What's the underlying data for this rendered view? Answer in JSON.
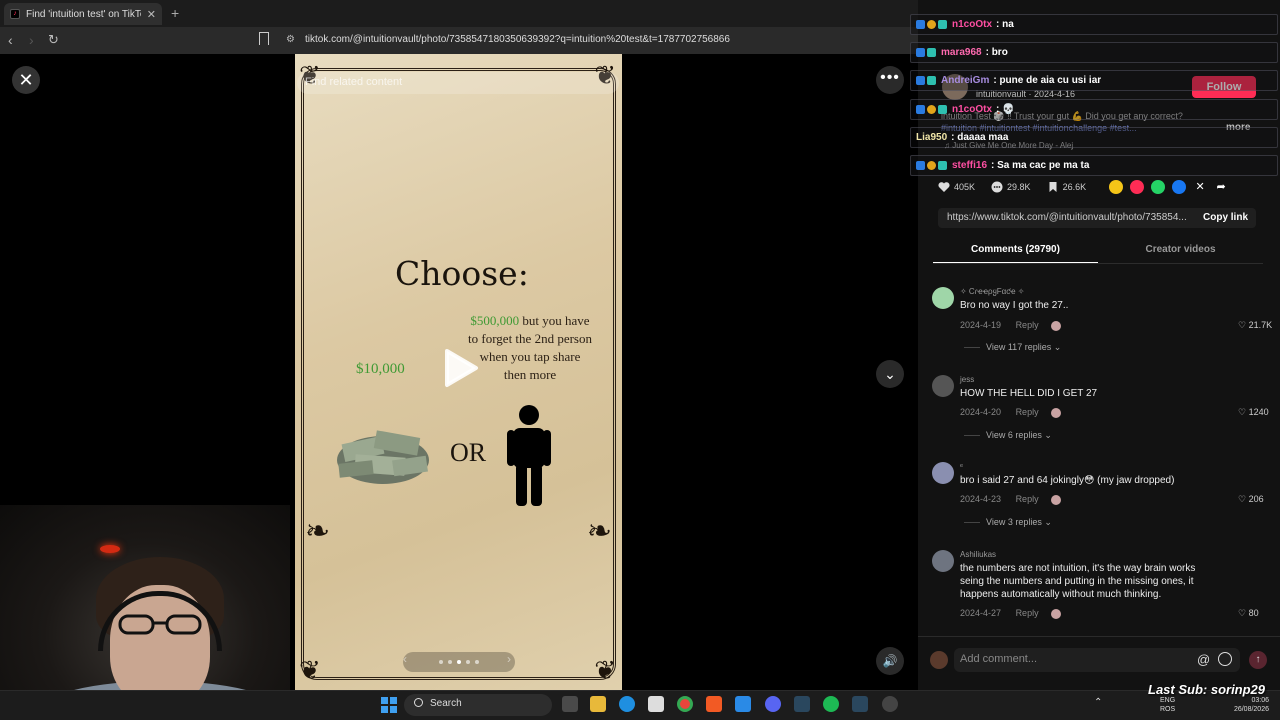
{
  "browser": {
    "tab_title": "Find 'intuition test' on TikTok | Ti",
    "tab_close": "✕",
    "new_tab": "+",
    "url": "tiktok.com/@intuitionvault/photo/7358547180350639392?q=intuition%20test&t=1787702756866"
  },
  "photo": {
    "related_pill": "Find related content",
    "heading": "Choose:",
    "option_a": "$10,000",
    "option_b_money": "$500,000",
    "option_b_rest": " but you have to forget the 2nd person when you tap share then more",
    "or": "OR"
  },
  "author": {
    "name_date": "intuitionvault · 2024-4-16",
    "follow": "Follow",
    "desc": "intuition Test 🎲 ‼ Trust your gut 💪 Did you get any correct?",
    "tags": "#intuition #intuitiontest #intuitionchallenge #test...",
    "more": "more",
    "music": "♫  Just Give Me One More Day - Alej"
  },
  "stats": {
    "likes": "405K",
    "comments": "29.8K",
    "saves": "26.6K"
  },
  "link": {
    "url": "https://www.tiktok.com/@intuitionvault/photo/735854...",
    "copy": "Copy link"
  },
  "tabs": {
    "comments": "Comments (29790)",
    "creator": "Creator videos"
  },
  "comments": [
    {
      "user": "✧ CɾҽҽρყFαƈҽ ✧",
      "text": "Bro no way I got the 27..",
      "date": "2024-4-19",
      "reply": "Reply",
      "likes": "21.7K",
      "replies": "View 117 replies ⌄"
    },
    {
      "user": "jess",
      "text": "HOW THE HELL DID I GET 27",
      "date": "2024-4-20",
      "reply": "Reply",
      "likes": "1240",
      "replies": "View 6 replies ⌄"
    },
    {
      "user": "ᵉ",
      "text": "bro i said 27 and 64 jokingly😳 (my jaw dropped)",
      "date": "2024-4-23",
      "reply": "Reply",
      "likes": "206",
      "replies": "View 3 replies ⌄"
    },
    {
      "user": "Ashiliukas",
      "text": "the numbers are not intuition, it's the way brain works seing the numbers and putting in the missing ones, it happens automatically without much thinking.",
      "date": "2024-4-27",
      "reply": "Reply",
      "likes": "80"
    }
  ],
  "add_comment": {
    "placeholder": "Add comment...",
    "at": "@",
    "send": "↑"
  },
  "chat": [
    {
      "user": "n1coOtx",
      "user_color": "#ff4fa3",
      "msg": ": na"
    },
    {
      "user": "mara968",
      "user_color": "#ff6ab0",
      "msg": ": bro"
    },
    {
      "user": "AndreiGm",
      "user_color": "#a88de0",
      "msg": ": pune de aia cu usi iar"
    },
    {
      "user": "n1coOtx",
      "user_color": "#ff4fa3",
      "msg": ": 💀"
    },
    {
      "user": "Lia950",
      "user_color": "#f1e6a8",
      "msg": ": daaaa maa"
    },
    {
      "user": "steffi16",
      "user_color": "#ff4fa3",
      "msg": ": Sa ma cac pe ma ta"
    }
  ],
  "taskbar": {
    "search": "Search",
    "lang_1": "ENG",
    "lang_2": "ROS",
    "time": "03:06",
    "date": "26/08/2026"
  },
  "overlay": {
    "last_sub": "Last Sub: sorinp29"
  },
  "colors": {
    "accent": "#fe2c55",
    "money_green": "#3f9a34"
  }
}
